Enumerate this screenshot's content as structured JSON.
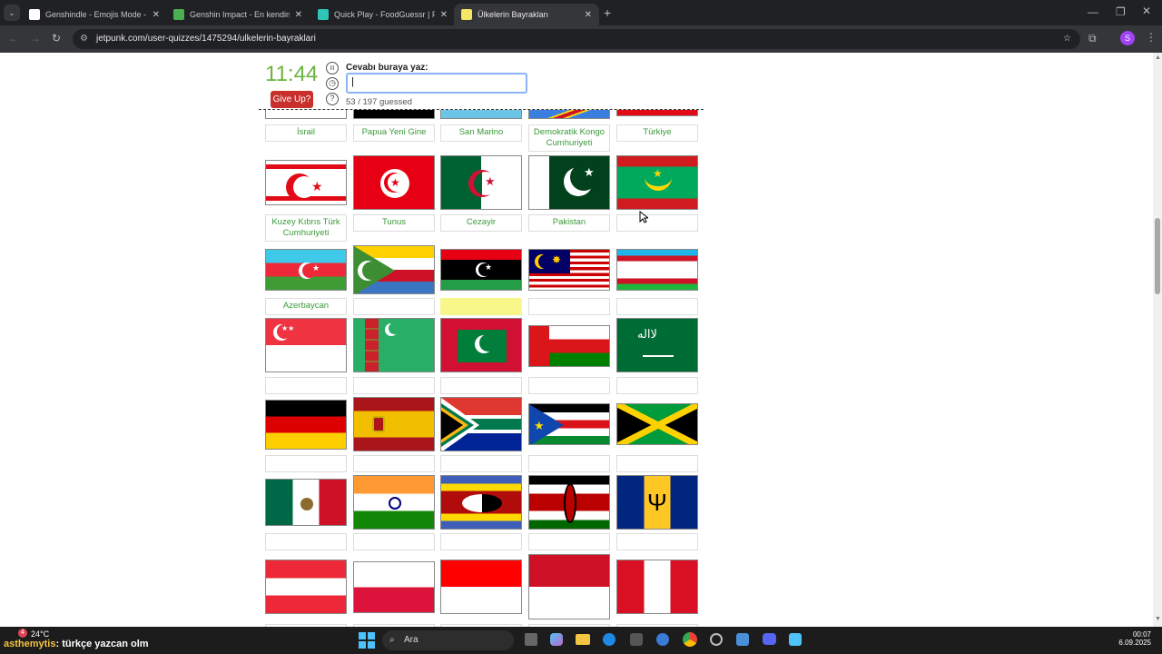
{
  "tabs": [
    {
      "title": "Genshindle - Emojis Mode - Gu",
      "icon_color": "#ffffff"
    },
    {
      "title": "Genshin Impact - En kendini fe",
      "icon_color": "#4caf50"
    },
    {
      "title": "Quick Play - FoodGuessr | Food",
      "icon_color": "#2ec4b6"
    },
    {
      "title": "Ülkelerin Bayrakları",
      "icon_color": "#f5e663"
    }
  ],
  "browser": {
    "url": "jetpunk.com/user-quizzes/1475294/ulkelerin-bayraklari",
    "profile_initial": "S"
  },
  "quiz": {
    "timer": "11:44",
    "give_up": "Give Up?",
    "prompt": "Cevabı buraya yaz:",
    "input_value": "|",
    "guessed": "53 / 197 guessed"
  },
  "flags": [
    [
      {
        "flag": "israel",
        "label": "İsrail"
      },
      {
        "flag": "png",
        "label": "Papua Yeni Gine"
      },
      {
        "flag": "sanmarino",
        "label": "San Marino"
      },
      {
        "flag": "drc",
        "label": "Demokratik Kongo Cumhuriyeti"
      },
      {
        "flag": "turkey",
        "label": "Türkiye"
      }
    ],
    [
      {
        "flag": "northcyprus",
        "label": "Kuzey Kıbrıs Türk Cumhuriyeti"
      },
      {
        "flag": "tunisia",
        "label": "Tunus"
      },
      {
        "flag": "algeria",
        "label": "Cezayir"
      },
      {
        "flag": "pakistan",
        "label": "Pakistan"
      },
      {
        "flag": "mauritania",
        "label": ""
      }
    ],
    [
      {
        "flag": "azerbaijan",
        "label": "Azerbaycan"
      },
      {
        "flag": "comoros",
        "label": ""
      },
      {
        "flag": "libya",
        "label": ""
      },
      {
        "flag": "malaysia",
        "label": ""
      },
      {
        "flag": "uzbekistan",
        "label": ""
      }
    ],
    [
      {
        "flag": "singapore",
        "label": ""
      },
      {
        "flag": "turkmenistan",
        "label": ""
      },
      {
        "flag": "maldives",
        "label": ""
      },
      {
        "flag": "oman",
        "label": ""
      },
      {
        "flag": "saudi",
        "label": ""
      }
    ],
    [
      {
        "flag": "germany",
        "label": ""
      },
      {
        "flag": "spain",
        "label": ""
      },
      {
        "flag": "southafrica",
        "label": ""
      },
      {
        "flag": "southsudan",
        "label": ""
      },
      {
        "flag": "jamaica",
        "label": ""
      }
    ],
    [
      {
        "flag": "mexico",
        "label": ""
      },
      {
        "flag": "india",
        "label": ""
      },
      {
        "flag": "eswatini",
        "label": ""
      },
      {
        "flag": "kenya",
        "label": ""
      },
      {
        "flag": "barbados",
        "label": ""
      }
    ],
    [
      {
        "flag": "austria",
        "label": ""
      },
      {
        "flag": "poland",
        "label": ""
      },
      {
        "flag": "indonesia",
        "label": ""
      },
      {
        "flag": "monaco",
        "label": ""
      },
      {
        "flag": "peru",
        "label": ""
      }
    ]
  ],
  "highlight_color": "#f7f78a",
  "taskbar": {
    "temperature": "24°C",
    "overlay_user": "asthemytis",
    "overlay_message": ": türkçe yazcan olm",
    "search": "Ara",
    "time": "00:07",
    "date": "6.09.2025"
  }
}
